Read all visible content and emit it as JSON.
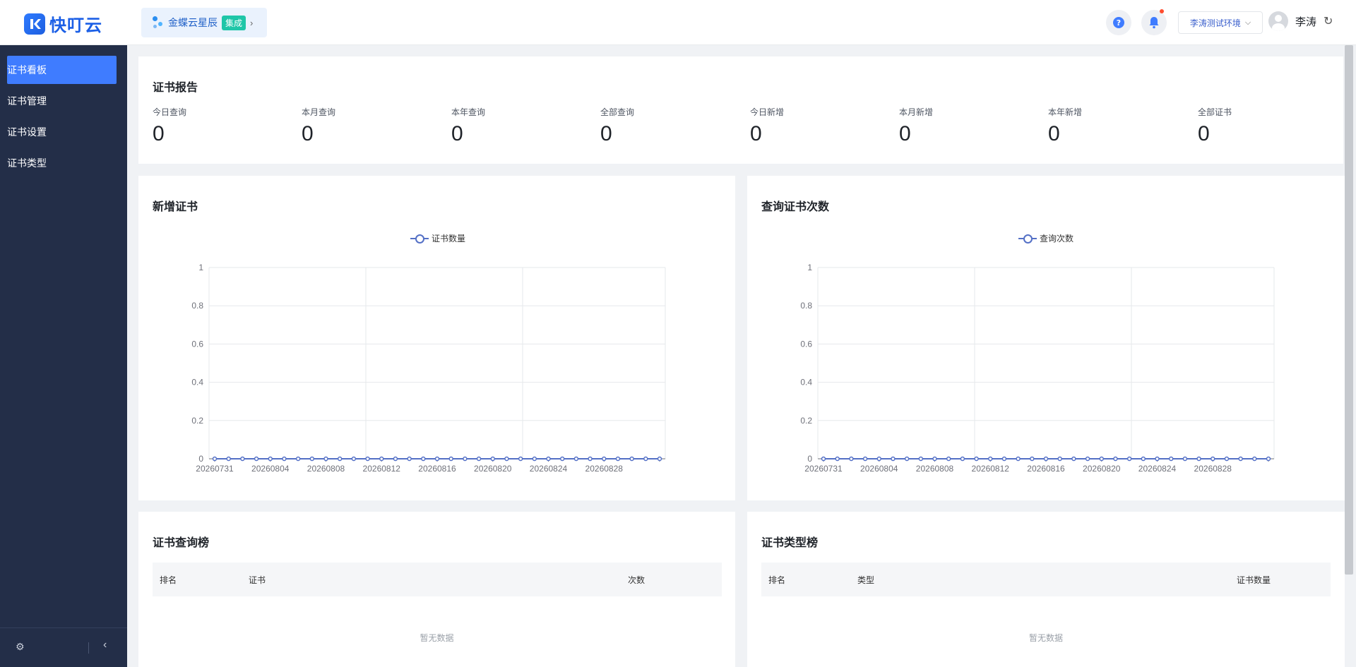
{
  "header": {
    "logo_text": "快叮云",
    "app_name": "金蝶云星辰",
    "app_badge": "集成",
    "env": "李涛测试环境",
    "user_name": "李涛",
    "help_icon": "question-circle-icon",
    "bell_icon": "bell-icon",
    "colors": {
      "brand": "#1b5fe6",
      "badge": "#1fc6a8"
    }
  },
  "sidebar": {
    "items": [
      {
        "label": "证书看板",
        "active": true
      },
      {
        "label": "证书管理",
        "active": false
      },
      {
        "label": "证书设置",
        "active": false
      },
      {
        "label": "证书类型",
        "active": false
      }
    ],
    "colors": {
      "bg": "#232e48",
      "active": "#3f7cff"
    }
  },
  "report": {
    "title": "证书报告",
    "stats": [
      {
        "label": "今日查询",
        "value": "0"
      },
      {
        "label": "本月查询",
        "value": "0"
      },
      {
        "label": "本年查询",
        "value": "0"
      },
      {
        "label": "全部查询",
        "value": "0"
      },
      {
        "label": "今日新增",
        "value": "0"
      },
      {
        "label": "本月新增",
        "value": "0"
      },
      {
        "label": "本年新增",
        "value": "0"
      },
      {
        "label": "全部证书",
        "value": "0"
      }
    ]
  },
  "charts": {
    "new": {
      "title": "新增证书",
      "legend": "证书数量"
    },
    "query": {
      "title": "查询证书次数",
      "legend": "查询次数"
    }
  },
  "chart_data": [
    {
      "type": "line",
      "title": "新增证书",
      "series": [
        {
          "name": "证书数量",
          "values": [
            0,
            0,
            0,
            0,
            0,
            0,
            0,
            0,
            0,
            0,
            0,
            0,
            0,
            0,
            0,
            0,
            0,
            0,
            0,
            0,
            0,
            0,
            0,
            0,
            0,
            0,
            0,
            0,
            0,
            0,
            0,
            0,
            0
          ]
        }
      ],
      "x": [
        "20260731",
        "20260801",
        "20260802",
        "20260803",
        "20260804",
        "20260805",
        "20260806",
        "20260807",
        "20260808",
        "20260809",
        "20260810",
        "20260811",
        "20260812",
        "20260813",
        "20260814",
        "20260815",
        "20260816",
        "20260817",
        "20260818",
        "20260819",
        "20260820",
        "20260821",
        "20260822",
        "20260823",
        "20260824",
        "20260825",
        "20260826",
        "20260827",
        "20260828",
        "20260829",
        "20260830",
        "20260831",
        "20260901"
      ],
      "x_tick_labels": [
        "20260731",
        "20260804",
        "20260808",
        "20260812",
        "20260816",
        "20260820",
        "20260824",
        "20260828"
      ],
      "y_ticks": [
        "0",
        "0.2",
        "0.4",
        "0.6",
        "0.8",
        "1"
      ],
      "ylim": [
        0,
        1
      ],
      "legend_position": "top-center",
      "color": "#5470c6"
    },
    {
      "type": "line",
      "title": "查询证书次数",
      "series": [
        {
          "name": "查询次数",
          "values": [
            0,
            0,
            0,
            0,
            0,
            0,
            0,
            0,
            0,
            0,
            0,
            0,
            0,
            0,
            0,
            0,
            0,
            0,
            0,
            0,
            0,
            0,
            0,
            0,
            0,
            0,
            0,
            0,
            0,
            0,
            0,
            0,
            0
          ]
        }
      ],
      "x": [
        "20260731",
        "20260801",
        "20260802",
        "20260803",
        "20260804",
        "20260805",
        "20260806",
        "20260807",
        "20260808",
        "20260809",
        "20260810",
        "20260811",
        "20260812",
        "20260813",
        "20260814",
        "20260815",
        "20260816",
        "20260817",
        "20260818",
        "20260819",
        "20260820",
        "20260821",
        "20260822",
        "20260823",
        "20260824",
        "20260825",
        "20260826",
        "20260827",
        "20260828",
        "20260829",
        "20260830",
        "20260831",
        "20260901"
      ],
      "x_tick_labels": [
        "20260731",
        "20260804",
        "20260808",
        "20260812",
        "20260816",
        "20260820",
        "20260824",
        "20260828"
      ],
      "y_ticks": [
        "0",
        "0.2",
        "0.4",
        "0.6",
        "0.8",
        "1"
      ],
      "ylim": [
        0,
        1
      ],
      "legend_position": "top-center",
      "color": "#5470c6"
    }
  ],
  "rank_query": {
    "title": "证书查询榜",
    "columns": [
      "排名",
      "证书",
      "次数"
    ],
    "empty": "暂无数据"
  },
  "rank_type": {
    "title": "证书类型榜",
    "columns": [
      "排名",
      "类型",
      "证书数量"
    ],
    "empty": "暂无数据"
  }
}
